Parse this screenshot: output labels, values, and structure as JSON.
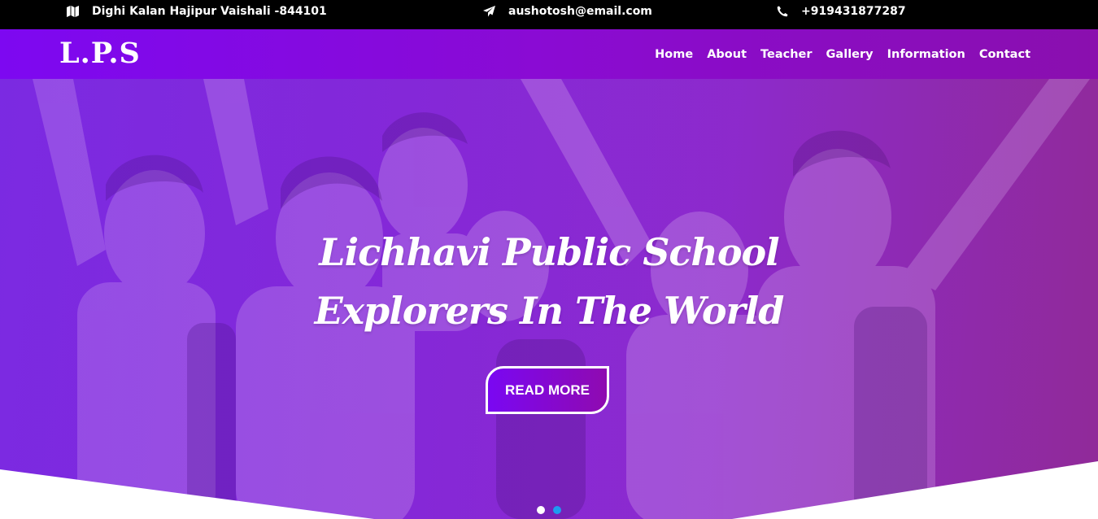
{
  "topbar": {
    "address": "Dighi Kalan Hajipur Vaishali -844101",
    "address_icon": "map-icon",
    "email": "aushotosh@email.com",
    "email_icon": "paper-plane-icon",
    "phone": "+919431877287",
    "phone_icon": "phone-icon"
  },
  "navbar": {
    "logo": "L.P.S",
    "links": [
      "Home",
      "About",
      "Teacher",
      "Gallery",
      "Information",
      "Contact"
    ]
  },
  "hero": {
    "title_line1": "Lichhavi Public School",
    "title_line2": "Explorers In The World",
    "button": "READ MORE",
    "slides": 2,
    "active_slide": 2
  },
  "colors": {
    "topbar_bg": "#000000",
    "nav_gradient_start": "#7d08f1",
    "nav_gradient_end": "#8a0fae",
    "hero_overlay": "#8429d9",
    "dot_inactive": "#ffffff",
    "dot_active": "#1e9bf0"
  }
}
